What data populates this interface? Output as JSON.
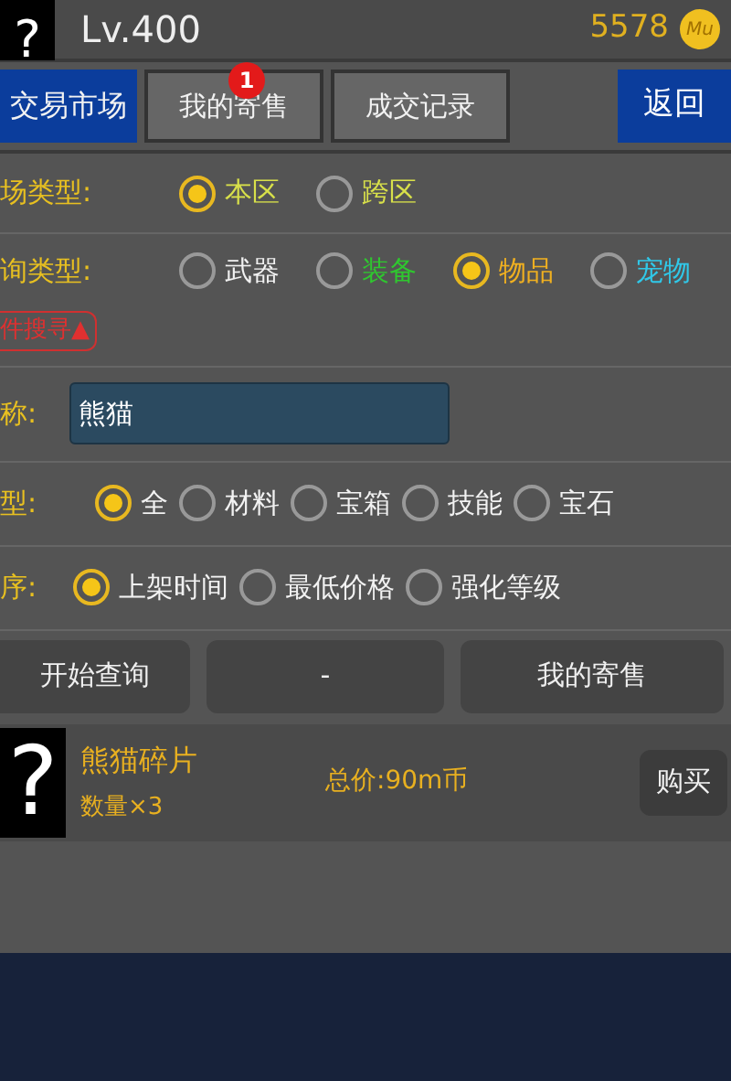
{
  "header": {
    "avatar": "?",
    "title": "Lv.400",
    "coins": "5578",
    "coin_icon": "Mu"
  },
  "tabs": [
    {
      "label": "交易市场",
      "selected": true
    },
    {
      "label": "我的寄售",
      "selected": false,
      "badge": "1"
    },
    {
      "label": "成交记录",
      "selected": false
    }
  ],
  "back_button": "返回",
  "filters": [
    {
      "label": "场类型:",
      "options": [
        {
          "label": "本区",
          "selected": true,
          "color": "#d8e04a"
        },
        {
          "label": "跨区",
          "selected": false,
          "color": "#d8e04a"
        }
      ]
    },
    {
      "label": "询类型:",
      "options": [
        {
          "label": "武器",
          "selected": false,
          "color": "#f2f2f2"
        },
        {
          "label": "装备",
          "selected": false,
          "color": "#2fc72f"
        },
        {
          "label": "物品",
          "selected": true,
          "color": "#f0b020"
        },
        {
          "label": "宠物",
          "selected": false,
          "color": "#30c8e8"
        }
      ]
    }
  ],
  "advanced_toggle": "件搜寻▲",
  "name_field": {
    "label": "称:",
    "value": "熊猫"
  },
  "filters2": [
    {
      "label": "型:",
      "options": [
        {
          "label": "全",
          "selected": true,
          "color": "#f2f2f2"
        },
        {
          "label": "材料",
          "selected": false,
          "color": "#f2f2f2"
        },
        {
          "label": "宝箱",
          "selected": false,
          "color": "#f2f2f2"
        },
        {
          "label": "技能",
          "selected": false,
          "color": "#f2f2f2"
        },
        {
          "label": "宝石",
          "selected": false,
          "color": "#f2f2f2"
        }
      ]
    },
    {
      "label": "序:",
      "options": [
        {
          "label": "上架时间",
          "selected": true,
          "color": "#f2f2f2"
        },
        {
          "label": "最低价格",
          "selected": false,
          "color": "#f2f2f2"
        },
        {
          "label": "强化等级",
          "selected": false,
          "color": "#f2f2f2"
        }
      ]
    }
  ],
  "actions": [
    "开始查询",
    "-",
    "我的寄售"
  ],
  "listings": [
    {
      "image": "?",
      "name": "熊猫碎片",
      "quantity": "数量×3",
      "price": "总价:90m币",
      "buy": "购买"
    }
  ]
}
